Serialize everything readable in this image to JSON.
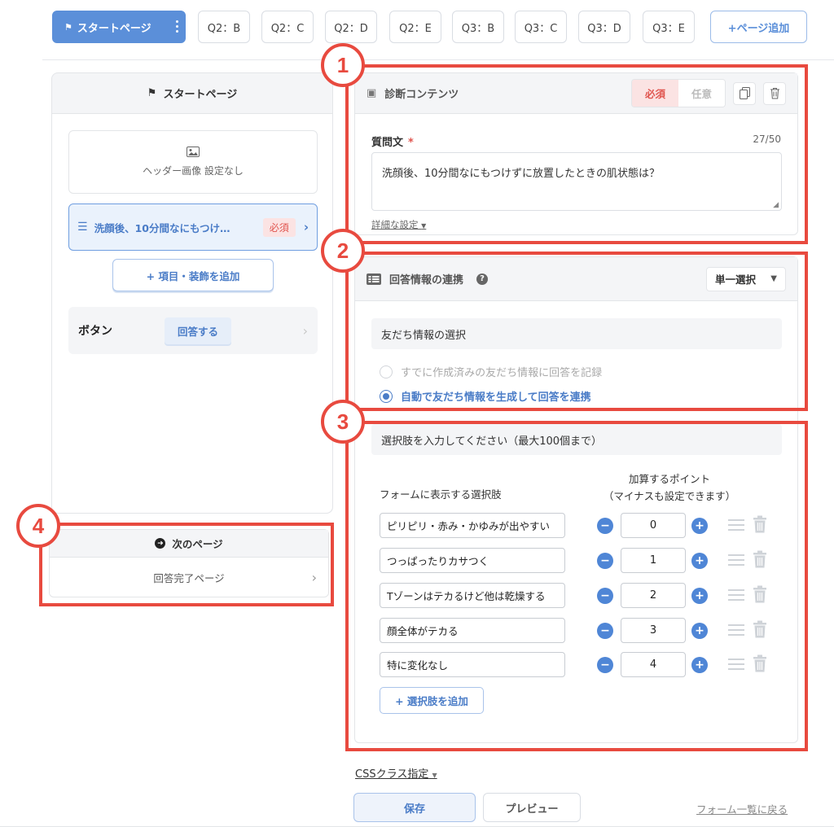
{
  "tabs": [
    {
      "label": "スタートページ",
      "active": true
    },
    {
      "label": "Q2：B"
    },
    {
      "label": "Q2：C"
    },
    {
      "label": "Q2：D"
    },
    {
      "label": "Q2：E"
    },
    {
      "label": "Q3：B"
    },
    {
      "label": "Q3：C"
    },
    {
      "label": "Q3：D"
    },
    {
      "label": "Q3：E"
    }
  ],
  "add_page_label": "+ページ追加",
  "left_panel": {
    "title": "スタートページ",
    "header_image": "ヘッダー画像 設定なし",
    "question_item": "洗顔後、10分間なにもつけ…",
    "question_badge": "必須",
    "add_item_label": "+ 項目・装飾を追加",
    "button_row_label": "ボタン",
    "button_answer_label": "回答する"
  },
  "next_page": {
    "title": "次のページ",
    "value": "回答完了ページ"
  },
  "content_panel": {
    "title": "診断コンテンツ",
    "required_label": "必須",
    "optional_label": "任意",
    "question_label": "質問文",
    "required_mark": "*",
    "counter": "27/50",
    "question_text": "洗顔後、10分間なにもつけずに放置したときの肌状態は？",
    "detail_link": "詳細な設定"
  },
  "link_panel": {
    "title": "回答情報の連携",
    "dropdown_value": "単一選択",
    "section_label": "友だち情報の選択",
    "radio_existing": "すでに作成済みの友だち情報に回答を記録",
    "radio_auto": "自動で友だち情報を生成して回答を連携"
  },
  "options_panel": {
    "instruction": "選択肢を入力してください（最大100個まで）",
    "col_options": "フォームに表示する選択肢",
    "col_points_1": "加算するポイント",
    "col_points_2": "（マイナスも設定できます）",
    "options": [
      {
        "text": "ピリピリ・赤み・かゆみが出やすい",
        "points": "0"
      },
      {
        "text": "つっぱったりカサつく",
        "points": "1"
      },
      {
        "text": "Tゾーンはテカるけど他は乾燥する",
        "points": "2"
      },
      {
        "text": "顔全体がテカる",
        "points": "3"
      },
      {
        "text": "特に変化なし",
        "points": "4"
      }
    ],
    "add_option_label": "+ 選択肢を追加"
  },
  "annotations": [
    "1",
    "2",
    "3",
    "4"
  ],
  "footer": {
    "css_link": "CSSクラス指定",
    "save_label": "保存",
    "preview_label": "プレビュー",
    "back_link": "フォーム一覧に戻る"
  }
}
